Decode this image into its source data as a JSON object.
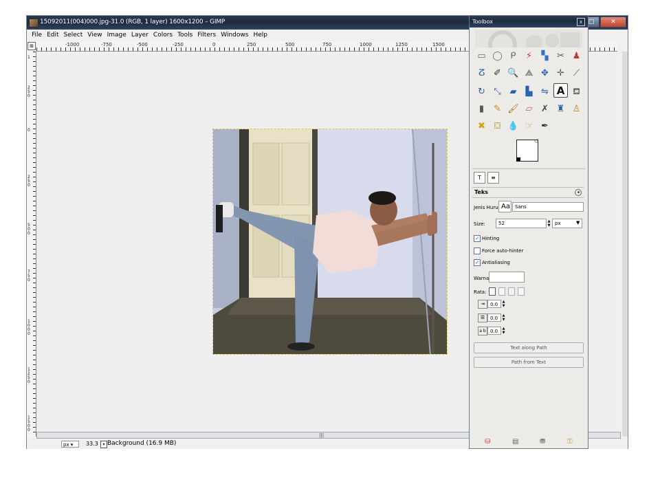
{
  "window": {
    "title": "15092011(004)000.jpg-31.0 (RGB, 1 layer) 1600x1200 – GIMP",
    "controls": {
      "minimize": "–",
      "maximize": "□",
      "close": "✕"
    }
  },
  "menu": [
    "File",
    "Edit",
    "Select",
    "View",
    "Image",
    "Layer",
    "Colors",
    "Tools",
    "Filters",
    "Windows",
    "Help"
  ],
  "ruler": {
    "h_labels": [
      "-1000",
      "-750",
      "-500",
      "-250",
      "0",
      "250",
      "500",
      "750",
      "1000",
      "1250",
      "1500"
    ],
    "v_labels": [
      "1",
      "2 5 0",
      "0",
      "2 5 0",
      "5 0 0",
      "7 5 0",
      "1 0 0 0",
      "1 2 5 0",
      "1 5 0 0"
    ]
  },
  "canvas": {
    "scroll_grip": "|||"
  },
  "status": {
    "unit": "px ▾",
    "zoom": "33.3 %",
    "layer_info": "Background (16.9 MB)"
  },
  "toolbox": {
    "title": "Toolbox",
    "close": "x",
    "tools": [
      {
        "name": "rect-select",
        "glyph": "▭"
      },
      {
        "name": "ellipse-select",
        "glyph": "◯"
      },
      {
        "name": "free-select",
        "glyph": "ᑭ"
      },
      {
        "name": "fuzzy-select",
        "glyph": "⚡"
      },
      {
        "name": "color-select",
        "glyph": "▚"
      },
      {
        "name": "scissors",
        "glyph": "✂"
      },
      {
        "name": "foreground-select",
        "glyph": "♟"
      },
      {
        "name": "paths",
        "glyph": "ⵒ"
      },
      {
        "name": "color-picker",
        "glyph": "✐"
      },
      {
        "name": "zoom",
        "glyph": "🔍"
      },
      {
        "name": "measure",
        "glyph": "⟁"
      },
      {
        "name": "move",
        "glyph": "✥"
      },
      {
        "name": "align",
        "glyph": "✛"
      },
      {
        "name": "crop",
        "glyph": "⟋"
      },
      {
        "name": "rotate",
        "glyph": "↻"
      },
      {
        "name": "scale",
        "glyph": "⤡"
      },
      {
        "name": "shear",
        "glyph": "▰"
      },
      {
        "name": "perspective",
        "glyph": "▙"
      },
      {
        "name": "flip",
        "glyph": "⇋"
      },
      {
        "name": "text",
        "glyph": "A"
      },
      {
        "name": "bucket-fill",
        "glyph": "⛾"
      },
      {
        "name": "blend",
        "glyph": "▮"
      },
      {
        "name": "pencil",
        "glyph": "✎"
      },
      {
        "name": "paintbrush",
        "glyph": "🖌"
      },
      {
        "name": "eraser",
        "glyph": "▱"
      },
      {
        "name": "airbrush",
        "glyph": "✗"
      },
      {
        "name": "ink",
        "glyph": "♜"
      },
      {
        "name": "clone",
        "glyph": "♙"
      },
      {
        "name": "heal",
        "glyph": "✖"
      },
      {
        "name": "perspective-clone",
        "glyph": "⛋"
      },
      {
        "name": "blur",
        "glyph": "💧"
      },
      {
        "name": "smudge",
        "glyph": "☞"
      },
      {
        "name": "dodge-burn",
        "glyph": "✒"
      }
    ],
    "active_tool": "text",
    "colors": {
      "foreground": "#ffffff",
      "background": "#000000",
      "swap": "↺"
    },
    "options": {
      "tab_icons": [
        "T",
        "≡"
      ],
      "title": "Teks",
      "menu_icon": "◂",
      "font_label": "Jenis Huruf",
      "font_preview": "Aa",
      "font_value": "Sans",
      "size_label": "Size:",
      "size_value": "52",
      "size_unit": "px",
      "hinting": "Hinting",
      "force_autohinter": "Force auto-hinter",
      "antialiasing": "Antialiasing",
      "hinting_checked": true,
      "force_checked": false,
      "antialias_checked": true,
      "color_label": "Warna:",
      "justify_label": "Rata:",
      "indent_value": "0.0",
      "line_spacing_value": "0.0",
      "letter_spacing_value": "0.0",
      "letter_icon": "a b",
      "text_along_path": "Text along Path",
      "path_from_text": "Path from Text",
      "check_mark": "✓"
    },
    "bottom_icons": [
      "⛁",
      "▤",
      "⛃",
      "⚿"
    ]
  }
}
